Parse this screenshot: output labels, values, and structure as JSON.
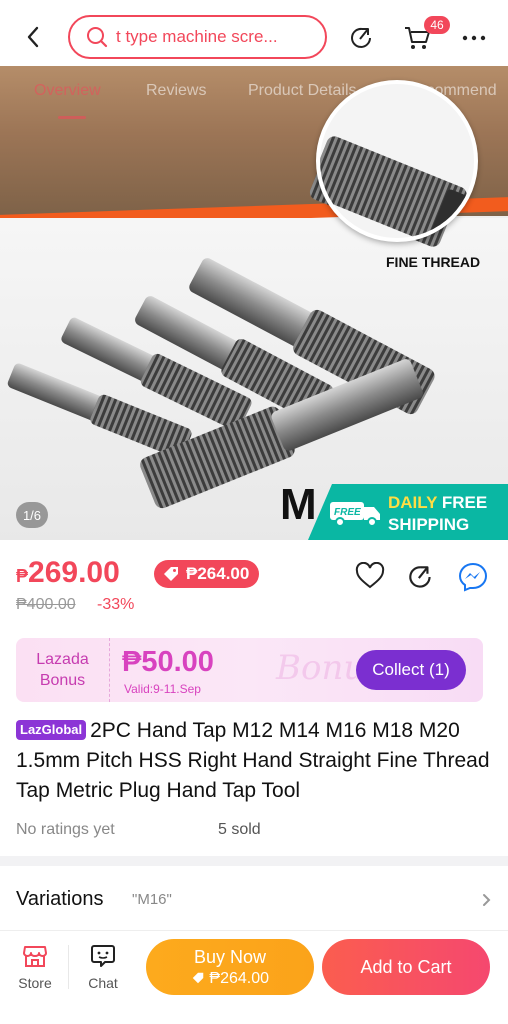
{
  "header": {
    "search_text": "t type machine scre...",
    "cart_count": "46"
  },
  "gallery": {
    "tabs": [
      "Overview",
      "Reviews",
      "Product Details",
      "Recommend"
    ],
    "active_tab": "Overview",
    "image_caption": "FINE THREAD",
    "image_letter": "M",
    "page_indicator": "1/6",
    "shipping_badge_small": "FREE",
    "shipping_line1a": "DAILY",
    "shipping_line1b": "FREE",
    "shipping_line2": "SHIPPING"
  },
  "price": {
    "currency": "₱",
    "current": "269.00",
    "voucher_price": "₱264.00",
    "original": "₱400.00",
    "discount": "-33%"
  },
  "bonus": {
    "label_line1": "Lazada",
    "label_line2": "Bonus",
    "amount": "₱50.00",
    "valid": "Valid:9-11.Sep",
    "watermark": "Bonus",
    "collect_label": "Collect (1)"
  },
  "product": {
    "badge": "LazGlobal",
    "title": "2PC Hand Tap M12 M14 M16 M18 M20 1.5mm Pitch HSS Right Hand Straight Fine Thread Tap Metric Plug Hand Tap Tool",
    "rating_text": "No ratings yet",
    "sold_text": "5 sold"
  },
  "variations": {
    "title": "Variations",
    "selected": "\"M16\""
  },
  "bottom_bar": {
    "store_label": "Store",
    "chat_label": "Chat",
    "buy_now_label": "Buy Now",
    "buy_now_price": "₱264.00",
    "add_to_cart_label": "Add to Cart"
  },
  "colors": {
    "accent": "#f2475a",
    "bonus_purple": "#7b2fd0",
    "buy_now": "#fdaa1d",
    "shipping_teal": "#0ab7a3"
  },
  "icons": [
    "back-icon",
    "search-icon",
    "share-icon",
    "cart-icon",
    "more-icon",
    "heart-icon",
    "messenger-icon",
    "store-icon",
    "chat-icon",
    "chevron-right-icon",
    "voucher-icon"
  ]
}
